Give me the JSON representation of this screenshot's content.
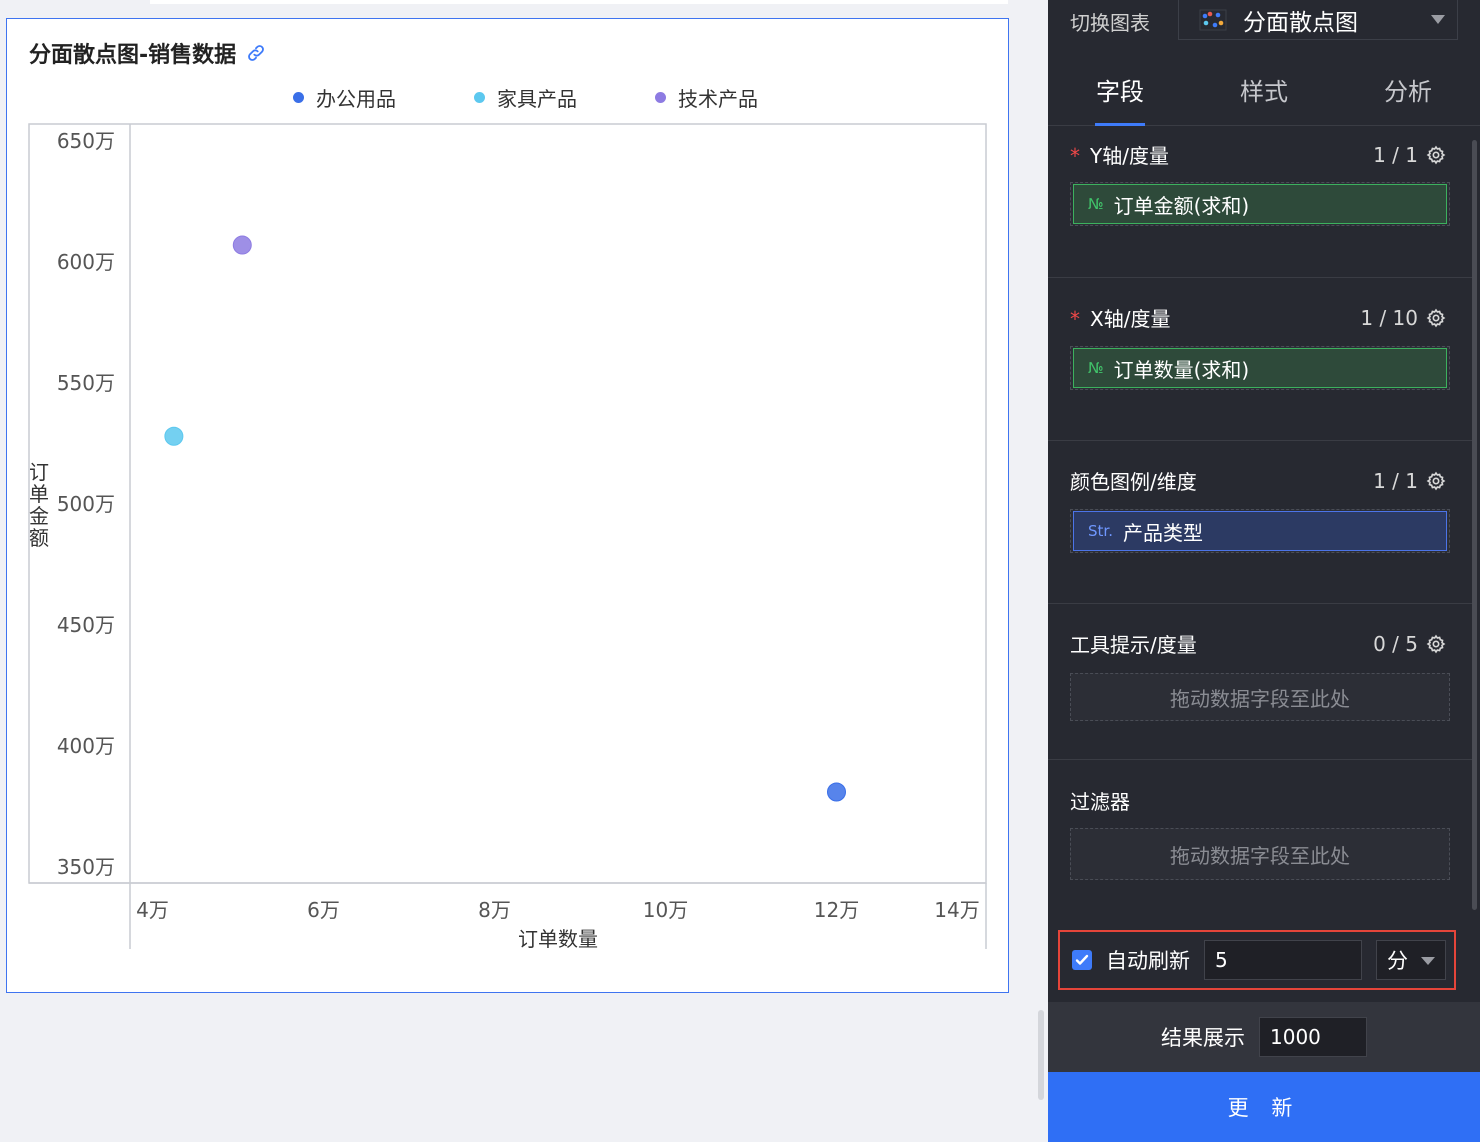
{
  "chart_title": "分面散点图-销售数据",
  "legend": [
    {
      "label": "办公用品",
      "color": "#3a6fe8"
    },
    {
      "label": "家具产品",
      "color": "#5cc8ef"
    },
    {
      "label": "技术产品",
      "color": "#8d7be2"
    }
  ],
  "chart_data": {
    "type": "scatter",
    "title": "分面散点图-销售数据",
    "xlabel": "订单数量",
    "ylabel": "订单金额",
    "x_ticks": [
      "4万",
      "6万",
      "8万",
      "10万",
      "12万",
      "14万"
    ],
    "y_ticks": [
      "650万",
      "600万",
      "550万",
      "500万",
      "450万",
      "400万",
      "350万"
    ],
    "series": [
      {
        "name": "办公用品",
        "color": "#3a6fe8",
        "points": [
          {
            "x": 120000,
            "y": 3810000
          }
        ]
      },
      {
        "name": "家具产品",
        "color": "#5cc8ef",
        "points": [
          {
            "x": 42500,
            "y": 5280000
          }
        ]
      },
      {
        "name": "技术产品",
        "color": "#8d7be2",
        "points": [
          {
            "x": 50500,
            "y": 6070000
          }
        ]
      }
    ]
  },
  "panel": {
    "switch_label": "切换图表",
    "chart_type": "分面散点图",
    "tabs": [
      "字段",
      "样式",
      "分析"
    ],
    "sections": {
      "y": {
        "label": "Y轴/度量",
        "count": "1 / 1",
        "field_tag": "№",
        "field": "订单金额(求和)"
      },
      "x": {
        "label": "X轴/度量",
        "count": "1 / 10",
        "field_tag": "№",
        "field": "订单数量(求和)"
      },
      "color": {
        "label": "颜色图例/维度",
        "count": "1 / 1",
        "field_tag": "Str.",
        "field": "产品类型"
      },
      "tooltip": {
        "label": "工具提示/度量",
        "count": "0 / 5",
        "placeholder": "拖动数据字段至此处"
      },
      "filter": {
        "label": "过滤器",
        "placeholder": "拖动数据字段至此处"
      }
    },
    "auto_refresh": {
      "label": "自动刷新",
      "value": "5",
      "unit": "分"
    },
    "result": {
      "label": "结果展示",
      "value": "1000"
    },
    "update_button": "更 新"
  }
}
